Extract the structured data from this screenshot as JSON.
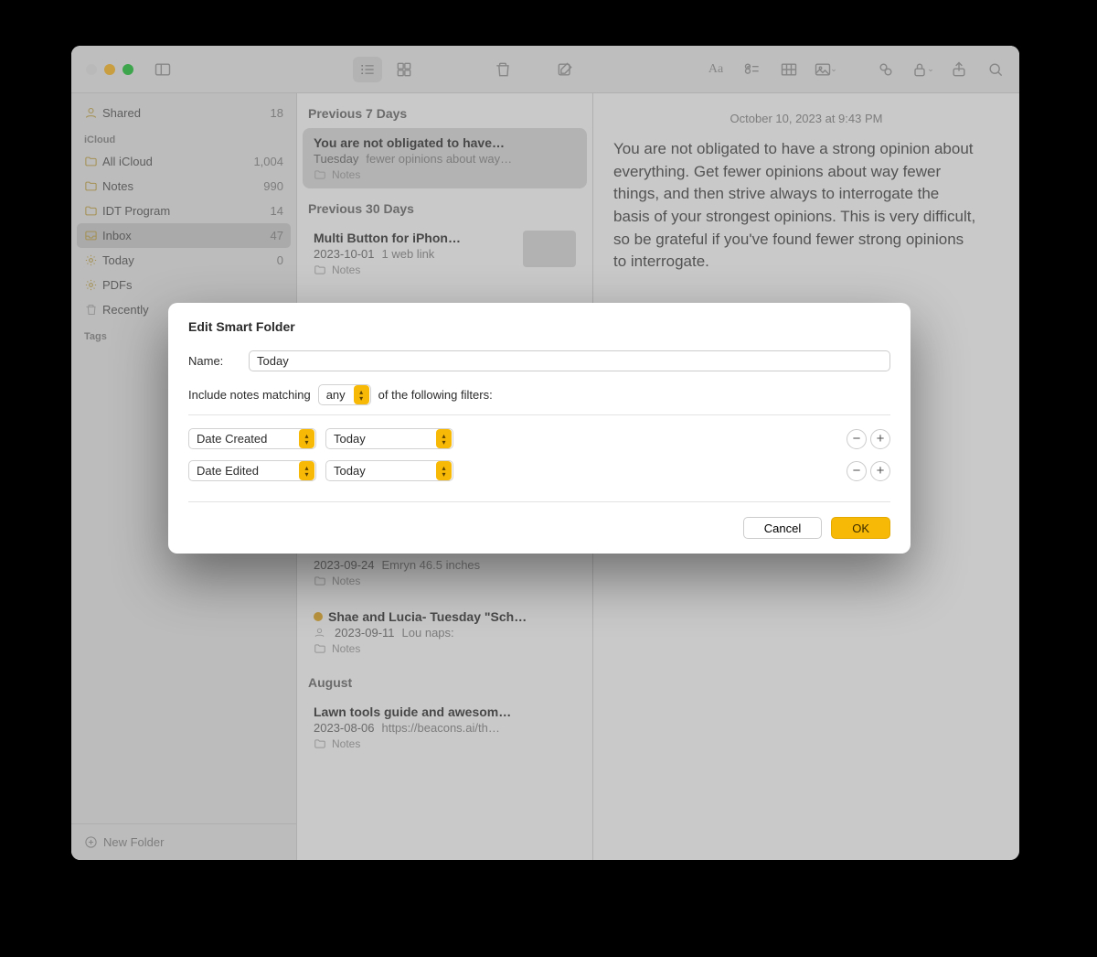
{
  "sidebar": {
    "shared": {
      "label": "Shared",
      "count": "18"
    },
    "icloud_header": "iCloud",
    "items": [
      {
        "label": "All iCloud",
        "count": "1,004"
      },
      {
        "label": "Notes",
        "count": "990"
      },
      {
        "label": "IDT Program",
        "count": "14"
      },
      {
        "label": "Inbox",
        "count": "47"
      },
      {
        "label": "Today",
        "count": "0"
      },
      {
        "label": "PDFs",
        "count": ""
      },
      {
        "label": "Recently",
        "count": ""
      }
    ],
    "tags_header": "Tags",
    "new_folder": "New Folder"
  },
  "notelist": {
    "sections": [
      {
        "header": "Previous 7 Days",
        "items": [
          {
            "title": "You are not obligated to have…",
            "date": "Tuesday",
            "snippet": "fewer opinions about way…",
            "folder": "Notes",
            "selected": true
          }
        ]
      },
      {
        "header": "Previous 30 Days",
        "items": [
          {
            "title": "Multi Button for iPhon…",
            "date": "2023-10-01",
            "snippet": "1 web link",
            "folder": "Notes",
            "thumb": true
          }
        ]
      },
      {
        "header": "",
        "items": [
          {
            "title": "",
            "date": "2023-09-24",
            "snippet": "Emryn 46.5 inches",
            "folder": "Notes"
          },
          {
            "title": "Shae and Lucia- Tuesday \"Sch…",
            "date": "2023-09-11",
            "snippet": "Lou naps:",
            "folder": "Notes",
            "shared": true,
            "gold": true
          }
        ]
      },
      {
        "header": "August",
        "items": [
          {
            "title": "Lawn tools guide and awesom…",
            "date": "2023-08-06",
            "snippet": "https://beacons.ai/th…",
            "folder": "Notes"
          }
        ]
      }
    ]
  },
  "content": {
    "date": "October 10, 2023 at 9:43 PM",
    "body": "You are not obligated to have a strong opinion about everything. Get fewer opinions about way fewer things, and then strive always to interrogate the basis of your strongest opinions. This is very difficult, so be grateful if you've found fewer strong opinions to interrogate."
  },
  "modal": {
    "title": "Edit Smart Folder",
    "name_label": "Name:",
    "name_value": "Today",
    "match_pre": "Include notes matching",
    "match_mode": "any",
    "match_post": "of the following filters:",
    "filters": [
      {
        "field": "Date Created",
        "value": "Today"
      },
      {
        "field": "Date Edited",
        "value": "Today"
      }
    ],
    "cancel": "Cancel",
    "ok": "OK"
  }
}
